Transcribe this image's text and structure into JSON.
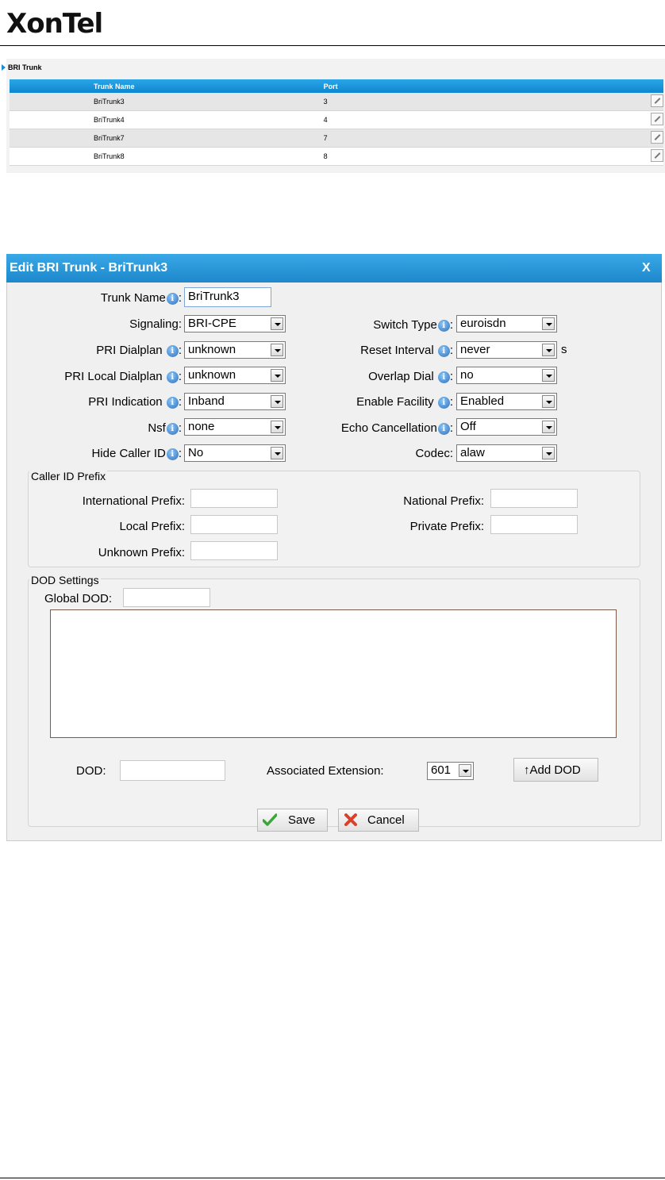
{
  "header": {
    "logo_text": "XonTel"
  },
  "trunk_list": {
    "title": "BRI Trunk",
    "columns": [
      "Trunk Name",
      "Port"
    ],
    "rows": [
      {
        "name": "BriTrunk3",
        "port": "3"
      },
      {
        "name": "BriTrunk4",
        "port": "4"
      },
      {
        "name": "BriTrunk7",
        "port": "7"
      },
      {
        "name": "BriTrunk8",
        "port": "8"
      }
    ]
  },
  "dialog": {
    "title": "Edit BRI Trunk - BriTrunk3",
    "close_label": "X",
    "fields": {
      "trunk_name": {
        "label": "Trunk Name",
        "value": "BriTrunk3"
      },
      "signaling": {
        "label": "Signaling:",
        "value": "BRI-CPE"
      },
      "switch_type": {
        "label": "Switch Type",
        "value": "euroisdn"
      },
      "pri_dialplan": {
        "label": "PRI Dialplan",
        "value": "unknown"
      },
      "reset_interval": {
        "label": "Reset Interval",
        "value": "never",
        "unit": "s"
      },
      "pri_local_dialplan": {
        "label": "PRI Local Dialplan",
        "value": "unknown"
      },
      "overlap_dial": {
        "label": "Overlap Dial",
        "value": "no"
      },
      "pri_indication": {
        "label": "PRI Indication",
        "value": "Inband"
      },
      "enable_facility": {
        "label": "Enable Facility",
        "value": "Enabled"
      },
      "nsf": {
        "label": "Nsf",
        "value": "none"
      },
      "echo_cancellation": {
        "label": "Echo Cancellation",
        "value": "Off"
      },
      "hide_caller_id": {
        "label": "Hide Caller ID",
        "value": "No"
      },
      "codec": {
        "label": "Codec:",
        "value": "alaw"
      }
    },
    "caller_id_prefix": {
      "title": "Caller ID Prefix",
      "international": {
        "label": "International Prefix:",
        "value": ""
      },
      "national": {
        "label": "National Prefix:",
        "value": ""
      },
      "local": {
        "label": "Local Prefix:",
        "value": ""
      },
      "private": {
        "label": "Private Prefix:",
        "value": ""
      },
      "unknown": {
        "label": "Unknown Prefix:",
        "value": ""
      }
    },
    "dod_settings": {
      "title": "DOD Settings",
      "global_dod_label": "Global DOD:",
      "global_dod_value": "",
      "dod_label": "DOD:",
      "dod_value": "",
      "assoc_ext_label": "Associated Extension:",
      "assoc_ext_value": "601",
      "add_dod_label": "↑Add DOD"
    },
    "save_label": "Save",
    "cancel_label": "Cancel"
  },
  "colors": {
    "accent": "#1d88cc",
    "row_alt": "#e6e6e6"
  }
}
